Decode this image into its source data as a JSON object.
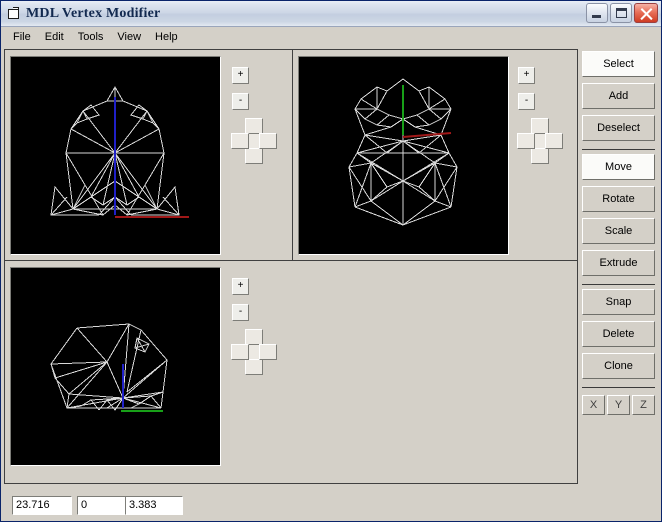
{
  "window": {
    "title": "MDL Vertex Modifier",
    "icon": "window-document-icon",
    "buttons": {
      "minimize": "minimize-icon",
      "maximize": "maximize-icon",
      "close": "close-icon"
    }
  },
  "menubar": {
    "items": [
      {
        "label": "File"
      },
      {
        "label": "Edit"
      },
      {
        "label": "Tools"
      },
      {
        "label": "View"
      },
      {
        "label": "Help"
      }
    ]
  },
  "viewports": [
    {
      "id": "front",
      "name": "front-view",
      "background": "#000000",
      "wireframe_color": "#d8d8d8",
      "axes": [
        {
          "name": "vertical-axis",
          "color": "#2020c8"
        },
        {
          "name": "horizontal-axis",
          "color": "#a01818"
        }
      ],
      "controls": {
        "zoom_in": "+",
        "zoom_out": "-",
        "pan_pad": [
          "pan-up",
          "pan-down",
          "pan-left",
          "pan-right"
        ]
      }
    },
    {
      "id": "top",
      "name": "top-view",
      "background": "#000000",
      "wireframe_color": "#d8d8d8",
      "axes": [
        {
          "name": "vertical-axis",
          "color": "#18a018"
        },
        {
          "name": "horizontal-axis",
          "color": "#a01818"
        }
      ],
      "controls": {
        "zoom_in": "+",
        "zoom_out": "-",
        "pan_pad": [
          "pan-up",
          "pan-down",
          "pan-left",
          "pan-right"
        ]
      }
    },
    {
      "id": "side",
      "name": "side-view",
      "background": "#000000",
      "wireframe_color": "#d8d8d8",
      "axes": [
        {
          "name": "vertical-axis",
          "color": "#2020c8"
        },
        {
          "name": "horizontal-axis",
          "color": "#18a018"
        }
      ],
      "controls": {
        "zoom_in": "+",
        "zoom_out": "-",
        "pan_pad": [
          "pan-up",
          "pan-down",
          "pan-left",
          "pan-right"
        ]
      }
    }
  ],
  "toolbar": {
    "groups": [
      {
        "buttons": [
          {
            "label": "Select",
            "active": true
          },
          {
            "label": "Add",
            "active": false
          },
          {
            "label": "Deselect",
            "active": false
          }
        ]
      },
      {
        "buttons": [
          {
            "label": "Move",
            "active": true
          },
          {
            "label": "Rotate",
            "active": false
          },
          {
            "label": "Scale",
            "active": false
          },
          {
            "label": "Extrude",
            "active": false
          }
        ]
      },
      {
        "buttons": [
          {
            "label": "Snap",
            "active": false
          },
          {
            "label": "Delete",
            "active": false
          },
          {
            "label": "Clone",
            "active": false
          }
        ]
      }
    ],
    "axis_buttons": [
      {
        "label": "X"
      },
      {
        "label": "Y"
      },
      {
        "label": "Z"
      }
    ]
  },
  "statusbar": {
    "coords": [
      {
        "name": "coordinate-x",
        "value": "23.716"
      },
      {
        "name": "coordinate-y",
        "value": "0"
      },
      {
        "name": "coordinate-z",
        "value": "3.383"
      }
    ]
  },
  "colors": {
    "window_face": "#d4d0c8",
    "canvas_background": "#000000",
    "wireframe": "#d8d8d8",
    "axis_x": "#a01818",
    "axis_y": "#18a018",
    "axis_z": "#2020c8",
    "titlebar_text": "#12294f"
  }
}
